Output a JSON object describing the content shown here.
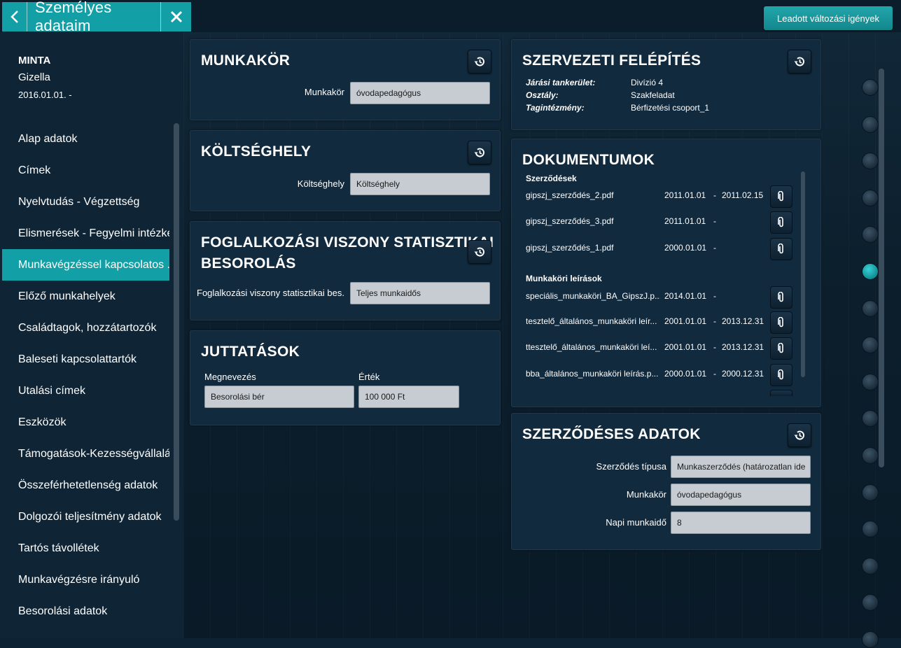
{
  "header": {
    "title": "Személyes adataim",
    "submitted_button": "Leadott változási igények"
  },
  "person": {
    "last_name": "MINTA",
    "first_name": "Gizella",
    "date": "2016.01.01. -"
  },
  "sidebar": {
    "items": [
      {
        "label": "Alap adatok"
      },
      {
        "label": "Címek"
      },
      {
        "label": "Nyelvtudás - Végzettség"
      },
      {
        "label": "Elismerések - Fegyelmi intézke."
      },
      {
        "label": "Munkavégzéssel kapcsolatos ..."
      },
      {
        "label": "Előző munkahelyek"
      },
      {
        "label": "Családtagok, hozzátartozók"
      },
      {
        "label": "Baleseti kapcsolattartók"
      },
      {
        "label": "Utalási címek"
      },
      {
        "label": "Eszközök"
      },
      {
        "label": "Támogatások-Kezességvállalá.."
      },
      {
        "label": "Összeférhetetlenség adatok"
      },
      {
        "label": "Dolgozói teljesítmény adatok"
      },
      {
        "label": "Tartós távollétek"
      },
      {
        "label": "Munkavégzésre irányuló"
      },
      {
        "label": "Besorolási adatok"
      }
    ]
  },
  "munkakor": {
    "title": "MUNKAKÖR",
    "label": "Munkakör",
    "value": "óvodapedagógus"
  },
  "koltseghely": {
    "title": "KÖLTSÉGHELY",
    "label": "Költséghely",
    "value": "Költséghely"
  },
  "foglalkozasi": {
    "title_line1": "FOGLALKOZÁSI VISZONY STATISZTIKAI",
    "title_line2": "BESOROLÁS",
    "label": "Foglalkozási viszony statisztikai bes.",
    "value": "Teljes munkaidős"
  },
  "juttatasok": {
    "title": "JUTTATÁSOK",
    "col_name": "Megnevezés",
    "col_value": "Érték",
    "row_name": "Besorolási bér",
    "row_value": "100 000 Ft"
  },
  "szervezeti": {
    "title": "SZERVEZETI FELÉPÍTÉS",
    "rows": [
      {
        "label": "Járási tankerület:",
        "value": "Divízió 4"
      },
      {
        "label": "Osztály:",
        "value": "Szakfeladat"
      },
      {
        "label": "Tagintézmény:",
        "value": "Bérfizetési csoport_1"
      }
    ]
  },
  "dokumentumok": {
    "title": "DOKUMENTUMOK",
    "group1": "Szerződések",
    "contracts": [
      {
        "name": "gipszj_szerződés_2.pdf",
        "from": "2011.01.01",
        "dash": "-",
        "to": "2011.02.15"
      },
      {
        "name": "gipszj_szerződés_3.pdf",
        "from": "2011.01.01",
        "dash": "-",
        "to": ""
      },
      {
        "name": "gipszj_szerződés_1.pdf",
        "from": "2000.01.01",
        "dash": "-",
        "to": ""
      }
    ],
    "group2": "Munkaköri leírások",
    "descriptions": [
      {
        "name": "speciális_munkaköri_BA_GipszJ.p...",
        "from": "2014.01.01",
        "dash": "-",
        "to": ""
      },
      {
        "name": "tesztelő_általános_munkaköri leír...",
        "from": "2001.01.01",
        "dash": "-",
        "to": "2013.12.31"
      },
      {
        "name": "ttesztelő_általános_munkaköri leí...",
        "from": "2001.01.01",
        "dash": "-",
        "to": "2013.12.31"
      },
      {
        "name": "bba_általános_munkaköri leírás.p...",
        "from": "2000.01.01",
        "dash": "-",
        "to": "2000.12.31"
      }
    ]
  },
  "szerzodeses": {
    "title": "SZERZŐDÉSES ADATOK",
    "type_label": "Szerződés típusa",
    "type_value": "Munkaszerződés (határozatlan ide",
    "job_label": "Munkakör",
    "job_value": "óvodapedagógus",
    "hours_label": "Napi munkaidő",
    "hours_value": "8"
  },
  "icons": {
    "back": "chevron-left-icon",
    "close": "close-icon",
    "history": "history-icon",
    "attachment": "paperclip-icon"
  },
  "colors": {
    "accent": "#12a0a6",
    "panel": "#112a3e",
    "field": "#c6ccd2"
  },
  "rail": {
    "dot_count": 16,
    "active_index": 5
  }
}
